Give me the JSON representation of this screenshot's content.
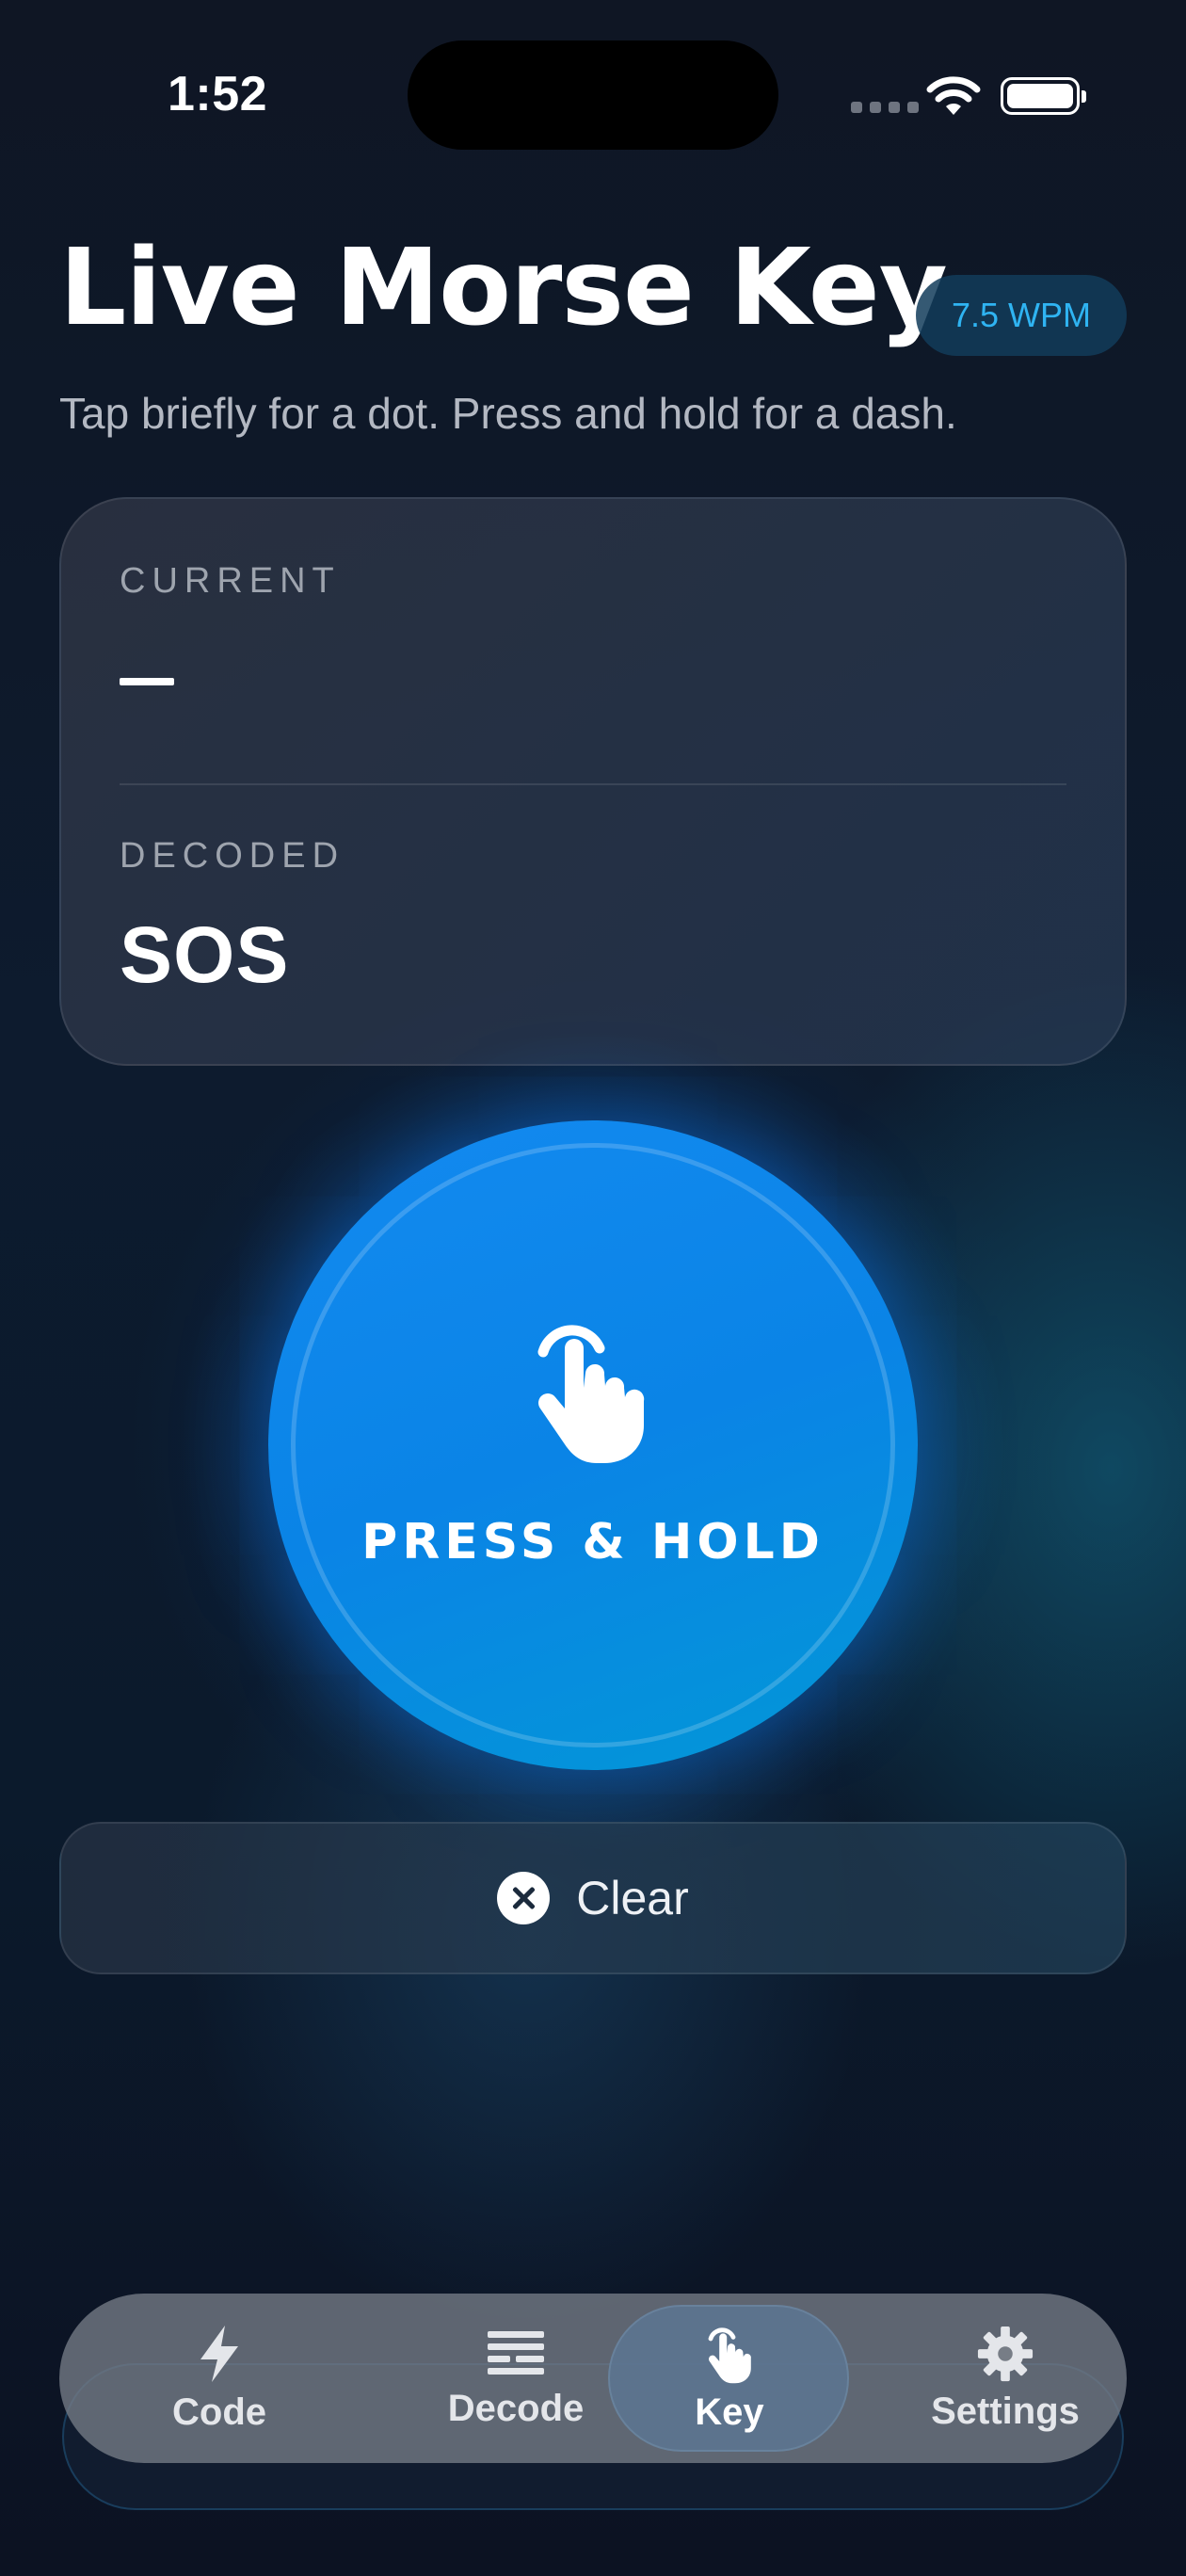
{
  "status_bar": {
    "time": "1:52"
  },
  "header": {
    "title": "Live Morse Key",
    "wpm_badge": "7.5 WPM",
    "subtitle": "Tap briefly for a dot. Press and hold for a dash."
  },
  "card": {
    "current_label": "CURRENT",
    "current_value": "–",
    "decoded_label": "DECODED",
    "decoded_value": "SOS"
  },
  "key": {
    "label": "PRESS & HOLD",
    "icon": "tap-hand-icon"
  },
  "clear": {
    "label": "Clear",
    "icon": "x-circle-icon"
  },
  "tabbar": {
    "selected": "Key",
    "items": [
      {
        "label": "Code",
        "icon": "bolt-icon"
      },
      {
        "label": "Decode",
        "icon": "lines-icon"
      },
      {
        "label": "Key",
        "icon": "tap-hand-icon"
      },
      {
        "label": "Settings",
        "icon": "gear-icon"
      }
    ]
  },
  "colors": {
    "accent": "#0a84e6",
    "badge_text": "#2fb4f2"
  }
}
